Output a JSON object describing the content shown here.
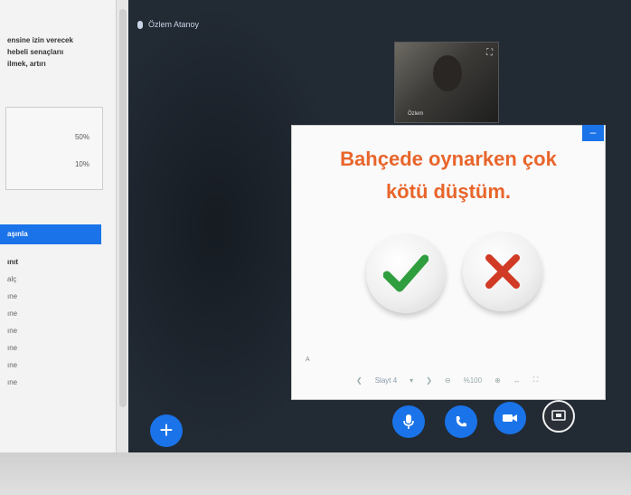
{
  "sidebar": {
    "poll_question": [
      "ensine izin verecek",
      "hebeli senaçlarıı",
      "ilmek, artırı"
    ],
    "poll_results": [
      {
        "pct": "50%"
      },
      {
        "pct": "10%"
      }
    ],
    "active_item": "aşınla",
    "items": [
      "ınıt",
      "alç",
      "ıne",
      "ıne",
      "ıne",
      "ıne",
      "ıne",
      "ıne"
    ]
  },
  "stage": {
    "presenter_name": "Özlem Atanoy",
    "webcam_name": "Özlem"
  },
  "slide": {
    "sentence_line1": "Bahçede oynarken çok",
    "sentence_line2": "kötü düştüm.",
    "corner_label": "A",
    "minimize_label": "–",
    "slide_select": "Slayt 4",
    "zoom_value": "%100"
  },
  "controls": {
    "add_label": "+"
  },
  "colors": {
    "accent": "#1a73e8",
    "slide_text": "#e8652b",
    "check_green": "#2f9e3e",
    "cross_red": "#d13b25",
    "stage_bg": "#222a34"
  }
}
